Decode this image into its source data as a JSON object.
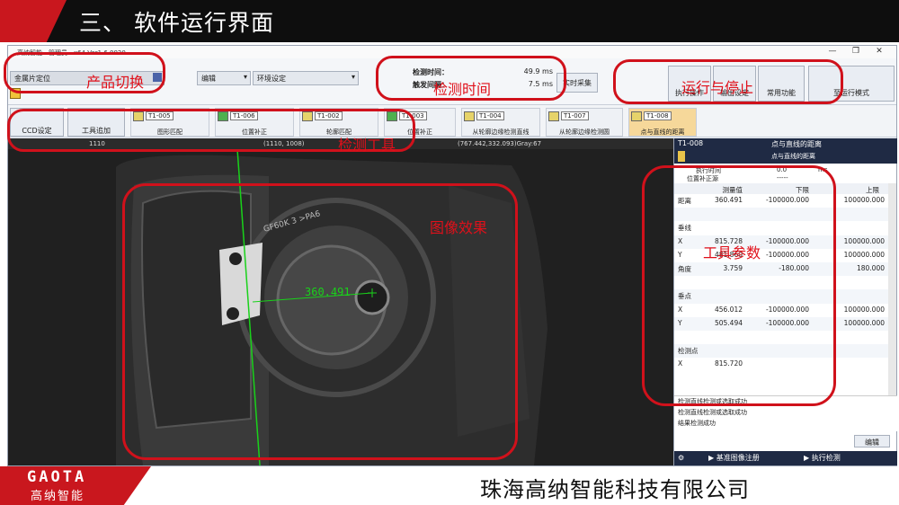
{
  "slide": {
    "title": "三、 软件运行界面",
    "logo_en": "GAOTA",
    "logo_cn": "高纳智能",
    "company": "珠海高纳智能科技有限公司"
  },
  "app": {
    "window_title": "高纳智能 - 管理员 - x64 Ver1.6.0020",
    "product": "金属片定位",
    "menus": [
      "编辑",
      "环境设定"
    ],
    "timing": {
      "detect_label": "检测时间：",
      "detect_value": "49.9 ms",
      "trigger_label": "触发间隔：",
      "trigger_value": "7.5 ms"
    },
    "buttons": {
      "realtime": "实时采集",
      "run": "执行操作",
      "io": "输出设定",
      "common": "常用功能",
      "mode": "至运行模式",
      "ccd": "CCD设定",
      "add_tool": "工具追加",
      "edit": "编辑",
      "register": "基准图像注册",
      "execute": "执行检测"
    },
    "tools": [
      {
        "id": "T1-005",
        "name": "图形匹配"
      },
      {
        "id": "T1-006",
        "name": "位置补正"
      },
      {
        "id": "T1-002",
        "name": "轮廓匹配"
      },
      {
        "id": "T1-003",
        "name": "位置补正"
      },
      {
        "id": "T1-004",
        "name": "从轮廓边缘检测直线"
      },
      {
        "id": "T1-007",
        "name": "从轮廓边缘检测圆"
      },
      {
        "id": "T1-008",
        "name": "点与直线的距离"
      }
    ],
    "status": {
      "coord": "(767.442,332.093)Gray:67",
      "field_a": "1110",
      "field_b": "(1110, 1008)"
    },
    "viewer": {
      "measure_text": "360.491",
      "stamp": "GF60K 3 >PA6"
    }
  },
  "panel": {
    "tool_id": "T1-008",
    "tool_title": "点与直线的距离",
    "tool_subtitle": "点与直线的距离",
    "exec_label": "执行时间",
    "exec_value": "0.0",
    "exec_unit": "ms",
    "comp_label": "位置补正源",
    "comp_value": "-----",
    "col_headers": [
      "测量值",
      "下限",
      "上限"
    ],
    "rows": [
      {
        "name": "距离",
        "v": "360.491",
        "lo": "-100000.000",
        "hi": "100000.000"
      },
      {
        "name": "",
        "v": "",
        "lo": "",
        "hi": ""
      },
      {
        "name": "垂线",
        "v": "",
        "lo": "",
        "hi": ""
      },
      {
        "name": "X",
        "v": "815.728",
        "lo": "-100000.000",
        "hi": "100000.000"
      },
      {
        "name": "Y",
        "v": "481.860",
        "lo": "-100000.000",
        "hi": "100000.000"
      },
      {
        "name": "角度",
        "v": "3.759",
        "lo": "-180.000",
        "hi": "180.000"
      },
      {
        "name": "",
        "v": "",
        "lo": "",
        "hi": ""
      },
      {
        "name": "垂点",
        "v": "",
        "lo": "",
        "hi": ""
      },
      {
        "name": "X",
        "v": "456.012",
        "lo": "-100000.000",
        "hi": "100000.000"
      },
      {
        "name": "Y",
        "v": "505.494",
        "lo": "-100000.000",
        "hi": "100000.000"
      },
      {
        "name": "",
        "v": "",
        "lo": "",
        "hi": ""
      },
      {
        "name": "检测点",
        "v": "",
        "lo": "",
        "hi": ""
      },
      {
        "name": "X",
        "v": "815.720",
        "lo": "",
        "hi": ""
      }
    ],
    "log": [
      "检测直线检测或选取成功",
      "检测直线检测或选取成功",
      "结果检测成功"
    ]
  },
  "annotations": [
    "产品切换",
    "检测时间",
    "运行与停止",
    "检测工具",
    "图像效果",
    "工具参数"
  ]
}
